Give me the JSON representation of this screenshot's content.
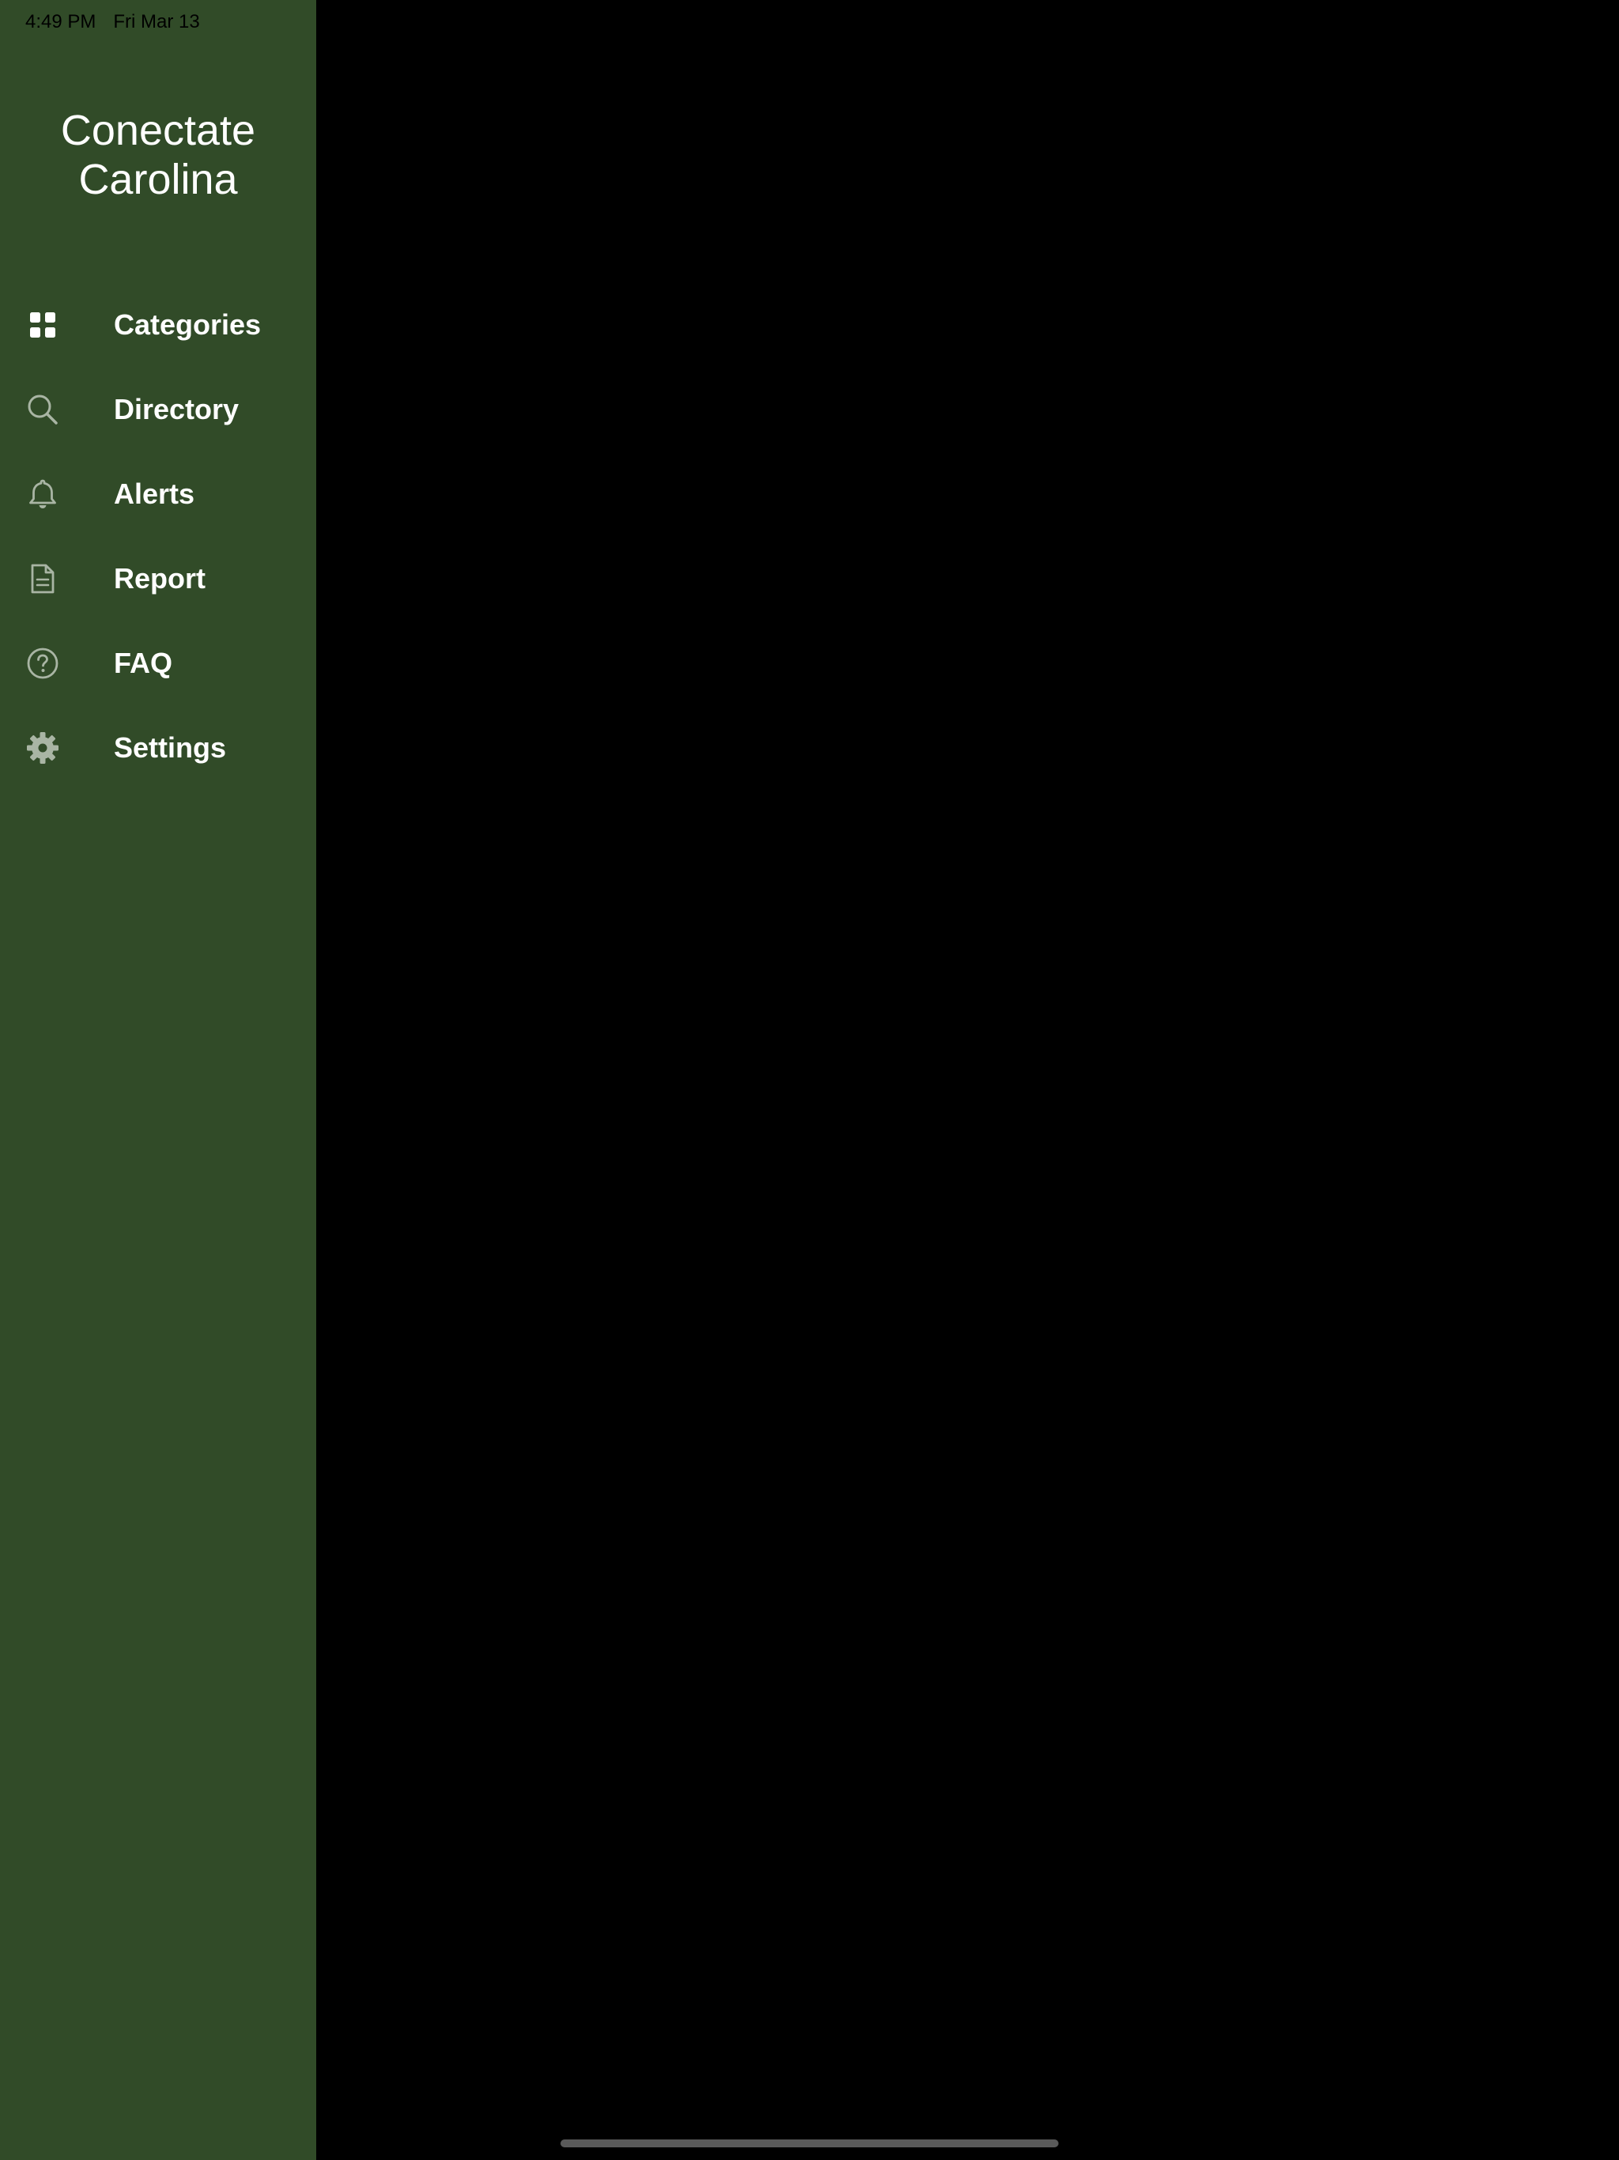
{
  "status_bar": {
    "time": "4:49 PM",
    "date": "Fri Mar 13"
  },
  "app": {
    "title_line1": "Conectate",
    "title_line2": "Carolina"
  },
  "sidebar": {
    "items": [
      {
        "label": "Categories",
        "icon": "grid-icon"
      },
      {
        "label": "Directory",
        "icon": "search-icon"
      },
      {
        "label": "Alerts",
        "icon": "bell-icon"
      },
      {
        "label": "Report",
        "icon": "document-icon"
      },
      {
        "label": "FAQ",
        "icon": "question-circle-icon"
      },
      {
        "label": "Settings",
        "icon": "gear-icon"
      }
    ]
  },
  "colors": {
    "sidebar_background": "#314b28",
    "main_background": "#000000",
    "icon_active": "#ffffff",
    "icon_inactive": "#a9b5a4",
    "text": "#ffffff",
    "home_indicator": "#5a5a5a"
  }
}
